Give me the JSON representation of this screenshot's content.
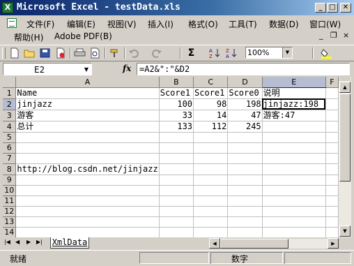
{
  "window": {
    "title": "Microsoft Excel - testData.xls",
    "app_icon_letter": "X"
  },
  "window_buttons": {
    "minimize": "_",
    "maximize": "□",
    "close": "✕"
  },
  "menu": {
    "items": [
      {
        "label": "文件(F)"
      },
      {
        "label": "编辑(E)"
      },
      {
        "label": "视图(V)"
      },
      {
        "label": "插入(I)"
      },
      {
        "label": "格式(O)"
      },
      {
        "label": "工具(T)"
      },
      {
        "label": "数据(D)"
      },
      {
        "label": "窗口(W)"
      },
      {
        "label": "帮助(H)"
      },
      {
        "label": "Adobe PDF(B)"
      }
    ],
    "doc_buttons": {
      "close": "×",
      "restore": "❐",
      "minimize": "_"
    }
  },
  "toolbar": {
    "icons": [
      "new-icon",
      "open-icon",
      "save-icon",
      "permission-icon",
      "print-icon",
      "print-preview-icon",
      "format-painter-icon",
      "undo-icon",
      "redo-icon",
      "autosum-icon",
      "sort-ascending-icon",
      "sort-descending-icon"
    ],
    "autosum_label": "Σ",
    "zoom_value": "100%",
    "fill_color": "#ffff00"
  },
  "formula_bar": {
    "name_box": "E2",
    "fx": "fx",
    "formula": "=A2&\":\"&D2"
  },
  "sheet": {
    "columns": [
      "A",
      "B",
      "C",
      "D",
      "E",
      "F"
    ],
    "selected_column": "E",
    "selected_row": "2",
    "rows": [
      {
        "row": "1",
        "cells": [
          "Name",
          "Score1",
          "Score1",
          "Score0",
          "说明",
          ""
        ]
      },
      {
        "row": "2",
        "cells": [
          "jinjazz",
          "100",
          "98",
          "198",
          "jinjazz:198",
          ""
        ]
      },
      {
        "row": "3",
        "cells": [
          "游客",
          "33",
          "14",
          "47",
          "游客:47",
          ""
        ]
      },
      {
        "row": "4",
        "cells": [
          "总计",
          "133",
          "112",
          "245",
          "",
          ""
        ]
      },
      {
        "row": "5",
        "cells": [
          "",
          "",
          "",
          "",
          "",
          ""
        ]
      },
      {
        "row": "6",
        "cells": [
          "",
          "",
          "",
          "",
          "",
          ""
        ]
      },
      {
        "row": "7",
        "cells": [
          "",
          "",
          "",
          "",
          "",
          ""
        ]
      },
      {
        "row": "8",
        "cells": [
          "http://blog.csdn.net/jinjazz",
          "",
          "",
          "",
          "",
          ""
        ]
      },
      {
        "row": "9",
        "cells": [
          "",
          "",
          "",
          "",
          "",
          ""
        ]
      },
      {
        "row": "10",
        "cells": [
          "",
          "",
          "",
          "",
          "",
          ""
        ]
      },
      {
        "row": "11",
        "cells": [
          "",
          "",
          "",
          "",
          "",
          ""
        ]
      },
      {
        "row": "12",
        "cells": [
          "",
          "",
          "",
          "",
          "",
          ""
        ]
      },
      {
        "row": "13",
        "cells": [
          "",
          "",
          "",
          "",
          "",
          ""
        ]
      },
      {
        "row": "14",
        "cells": [
          "",
          "",
          "",
          "",
          "",
          ""
        ]
      }
    ]
  },
  "sheet_tabs": {
    "active": "XmlData"
  },
  "status": {
    "left": "就绪",
    "mode": "数字"
  }
}
